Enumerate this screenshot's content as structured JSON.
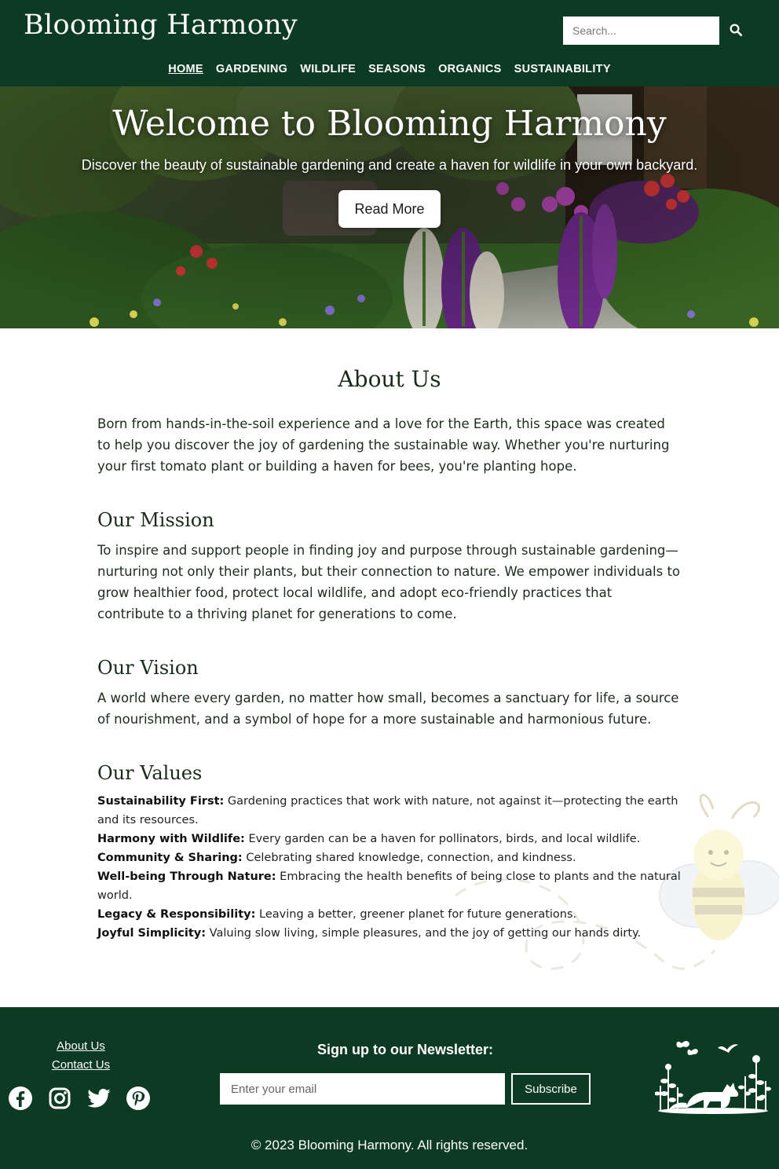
{
  "header": {
    "logo": "Blooming Harmony",
    "search_placeholder": "Search...",
    "nav": [
      {
        "label": "HOME"
      },
      {
        "label": "GARDENING"
      },
      {
        "label": "WILDLIFE"
      },
      {
        "label": "SEASONS"
      },
      {
        "label": "ORGANICS"
      },
      {
        "label": "SUSTAINABILITY"
      }
    ]
  },
  "hero": {
    "title": "Welcome to Blooming Harmony",
    "subtitle": "Discover the beauty of sustainable gardening and create a haven for wildlife in your own backyard.",
    "button": "Read More"
  },
  "about": {
    "title": "About Us",
    "intro": "Born from hands-in-the-soil experience and a love for the Earth, this space was created to help you discover the joy of gardening the sustainable way. Whether you're nurturing your first tomato plant or building a haven for bees, you're planting hope.",
    "mission_title": "Our Mission",
    "mission": "To inspire and support people in finding joy and purpose through sustainable gardening—nurturing not only their plants, but their connection to nature. We empower individuals to grow healthier food, protect local wildlife, and adopt eco-friendly practices that contribute to a thriving planet for generations to come.",
    "vision_title": "Our Vision",
    "vision": "A world where every garden, no matter how small, becomes a sanctuary for life, a source of nourishment, and a symbol of hope for a more sustainable and harmonious future.",
    "values_title": "Our Values",
    "values": [
      {
        "name": "Sustainability First:",
        "text": "Gardening practices that work with nature, not against it—protecting the earth and its resources."
      },
      {
        "name": "Harmony with Wildlife:",
        "text": "Every garden can be a haven for pollinators, birds, and local wildlife."
      },
      {
        "name": "Community & Sharing:",
        "text": "Celebrating shared knowledge, connection, and kindness."
      },
      {
        "name": "Well-being Through Nature:",
        "text": "Embracing the health benefits of being close to plants and the natural world."
      },
      {
        "name": "Legacy & Responsibility:",
        "text": "Leaving a better, greener planet for future generations."
      },
      {
        "name": "Joyful Simplicity:",
        "text": "Valuing slow living, simple pleasures, and the joy of getting our hands dirty."
      }
    ]
  },
  "footer": {
    "links": [
      "About Us",
      "Contact Us"
    ],
    "socials": [
      "facebook-icon",
      "instagram-icon",
      "twitter-icon",
      "pinterest-icon"
    ],
    "newsletter_title": "Sign up to our Newsletter:",
    "email_placeholder": "Enter your email",
    "subscribe": "Subscribe",
    "copyright": "© 2023 Blooming Harmony. All rights reserved."
  },
  "colors": {
    "brand_green": "#0d3a22",
    "text": "#1f2a1f"
  }
}
